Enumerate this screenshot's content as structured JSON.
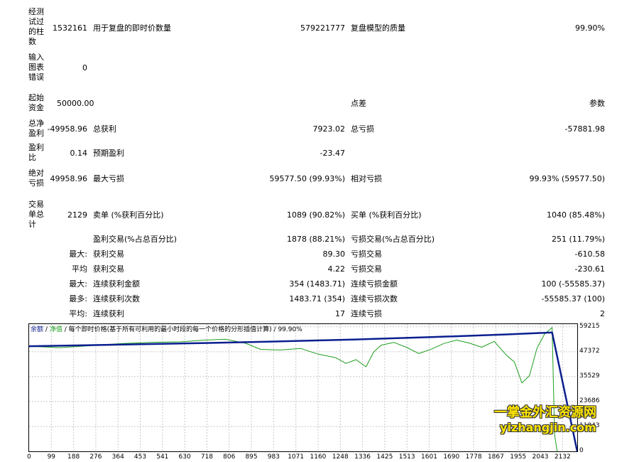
{
  "report": {
    "bars": {
      "label": "经测试过的柱数",
      "value": "1532161"
    },
    "ticks": {
      "label": "用于复盘的即时价数量",
      "value": "579221777"
    },
    "quality": {
      "label": "复盘模型的质量",
      "value": "99.90%"
    },
    "mismatch": {
      "label": "输入图表错误",
      "value": "0"
    },
    "deposit": {
      "label": "起始资金",
      "value": "50000.00"
    },
    "spread": {
      "label": "点差",
      "value": "参数"
    },
    "net_profit": {
      "label": "总净盈利",
      "value": "-49958.96"
    },
    "gross_profit": {
      "label": "总获利",
      "value": "7923.02"
    },
    "gross_loss": {
      "label": "总亏损",
      "value": "-57881.98"
    },
    "profit_factor": {
      "label": "盈利比",
      "value": "0.14"
    },
    "expected_payoff": {
      "label": "预期盈利",
      "value": "-23.47"
    },
    "abs_drawdown": {
      "label": "绝对亏损",
      "value": "49958.96"
    },
    "max_drawdown": {
      "label": "最大亏损",
      "value": "59577.50 (99.93%)"
    },
    "rel_drawdown": {
      "label": "相对亏损",
      "value": "99.93% (59577.50)"
    },
    "total_trades": {
      "label": "交易单总计",
      "value": "2129"
    },
    "short_positions": {
      "label": "卖单 (%获利百分比)",
      "value": "1089 (90.82%)"
    },
    "long_positions": {
      "label": "买单 (%获利百分比)",
      "value": "1040 (85.48%)"
    },
    "profit_trades": {
      "label": "盈利交易(%占总百分比)",
      "value": "1878 (88.21%)"
    },
    "loss_trades": {
      "label": "亏损交易(%占总百分比)",
      "value": "251 (11.79%)"
    },
    "largest": {
      "prefix": "最大:",
      "profit_label": "获利交易",
      "profit_value": "89.30",
      "loss_label": "亏损交易",
      "loss_value": "-610.58"
    },
    "average": {
      "prefix": "平均",
      "profit_label": "获利交易",
      "profit_value": "4.22",
      "loss_label": "亏损交易",
      "loss_value": "-230.61"
    },
    "max_consecutive": {
      "prefix": "最大:",
      "wins_label": "连续获利金额",
      "wins_value": "354 (1483.71)",
      "losses_label": "连续亏损金额",
      "losses_value": "100 (-55585.37)"
    },
    "max_consecutive_amount": {
      "prefix": "最多:",
      "profit_label": "连续获利次数",
      "profit_value": "1483.71 (354)",
      "loss_label": "连续亏损次数",
      "loss_value": "-55585.37 (100)"
    },
    "avg_consecutive": {
      "prefix": "平均:",
      "wins_label": "连续获利",
      "wins_value": "17",
      "losses_label": "连续亏损",
      "losses_value": "2"
    }
  },
  "chart_legend": {
    "balance": "余额",
    "sep1": "/",
    "equity": "净值",
    "sep2": "/",
    "model": "每个即时价格(基于所有可利用的最小时段的每一个价格的分形插值计算)",
    "sep3": "/",
    "quality": "99.90%"
  },
  "watermark": {
    "line1": "一掌金外汇资源网",
    "line2": "yizhangjin.com"
  },
  "colors": {
    "balance": "#0a1f8f",
    "equity": "#1e9e1e",
    "grid": "#c8c8c8"
  },
  "chart_data": {
    "type": "line",
    "xlabel": "",
    "ylabel": "",
    "x_ticks": [
      "0",
      "99",
      "188",
      "276",
      "364",
      "453",
      "541",
      "630",
      "718",
      "806",
      "895",
      "983",
      "1071",
      "1160",
      "1248",
      "1336",
      "1425",
      "1513",
      "1601",
      "1690",
      "1778",
      "1867",
      "1955",
      "2043",
      "2132"
    ],
    "y_ticks": [
      "59215",
      "47372",
      "35529",
      "23686",
      "11843",
      "0"
    ],
    "xlim": [
      0,
      2180
    ],
    "ylim": [
      0,
      60500
    ],
    "grid": true,
    "series": [
      {
        "name": "余额",
        "x": [
          0,
          300,
          700,
          1000,
          1300,
          1600,
          1900,
          2080,
          2180
        ],
        "y": [
          50000,
          50600,
          51500,
          52300,
          53200,
          54300,
          55600,
          56500,
          0
        ]
      },
      {
        "name": "净值",
        "x": [
          0,
          120,
          240,
          360,
          480,
          600,
          700,
          780,
          860,
          920,
          1000,
          1080,
          1150,
          1220,
          1260,
          1300,
          1340,
          1370,
          1400,
          1450,
          1500,
          1550,
          1600,
          1650,
          1700,
          1750,
          1800,
          1850,
          1900,
          1930,
          1960,
          1990,
          2020,
          2050,
          2080,
          2090,
          2100
        ],
        "y": [
          50000,
          49300,
          50200,
          51200,
          51800,
          52100,
          52900,
          53300,
          51400,
          48500,
          48200,
          48900,
          46200,
          44500,
          41800,
          43600,
          40200,
          47200,
          50500,
          51800,
          49500,
          46500,
          48600,
          51300,
          52900,
          51500,
          49500,
          52300,
          45500,
          42500,
          32500,
          36000,
          49000,
          55800,
          58900,
          8000,
          0
        ]
      }
    ]
  }
}
